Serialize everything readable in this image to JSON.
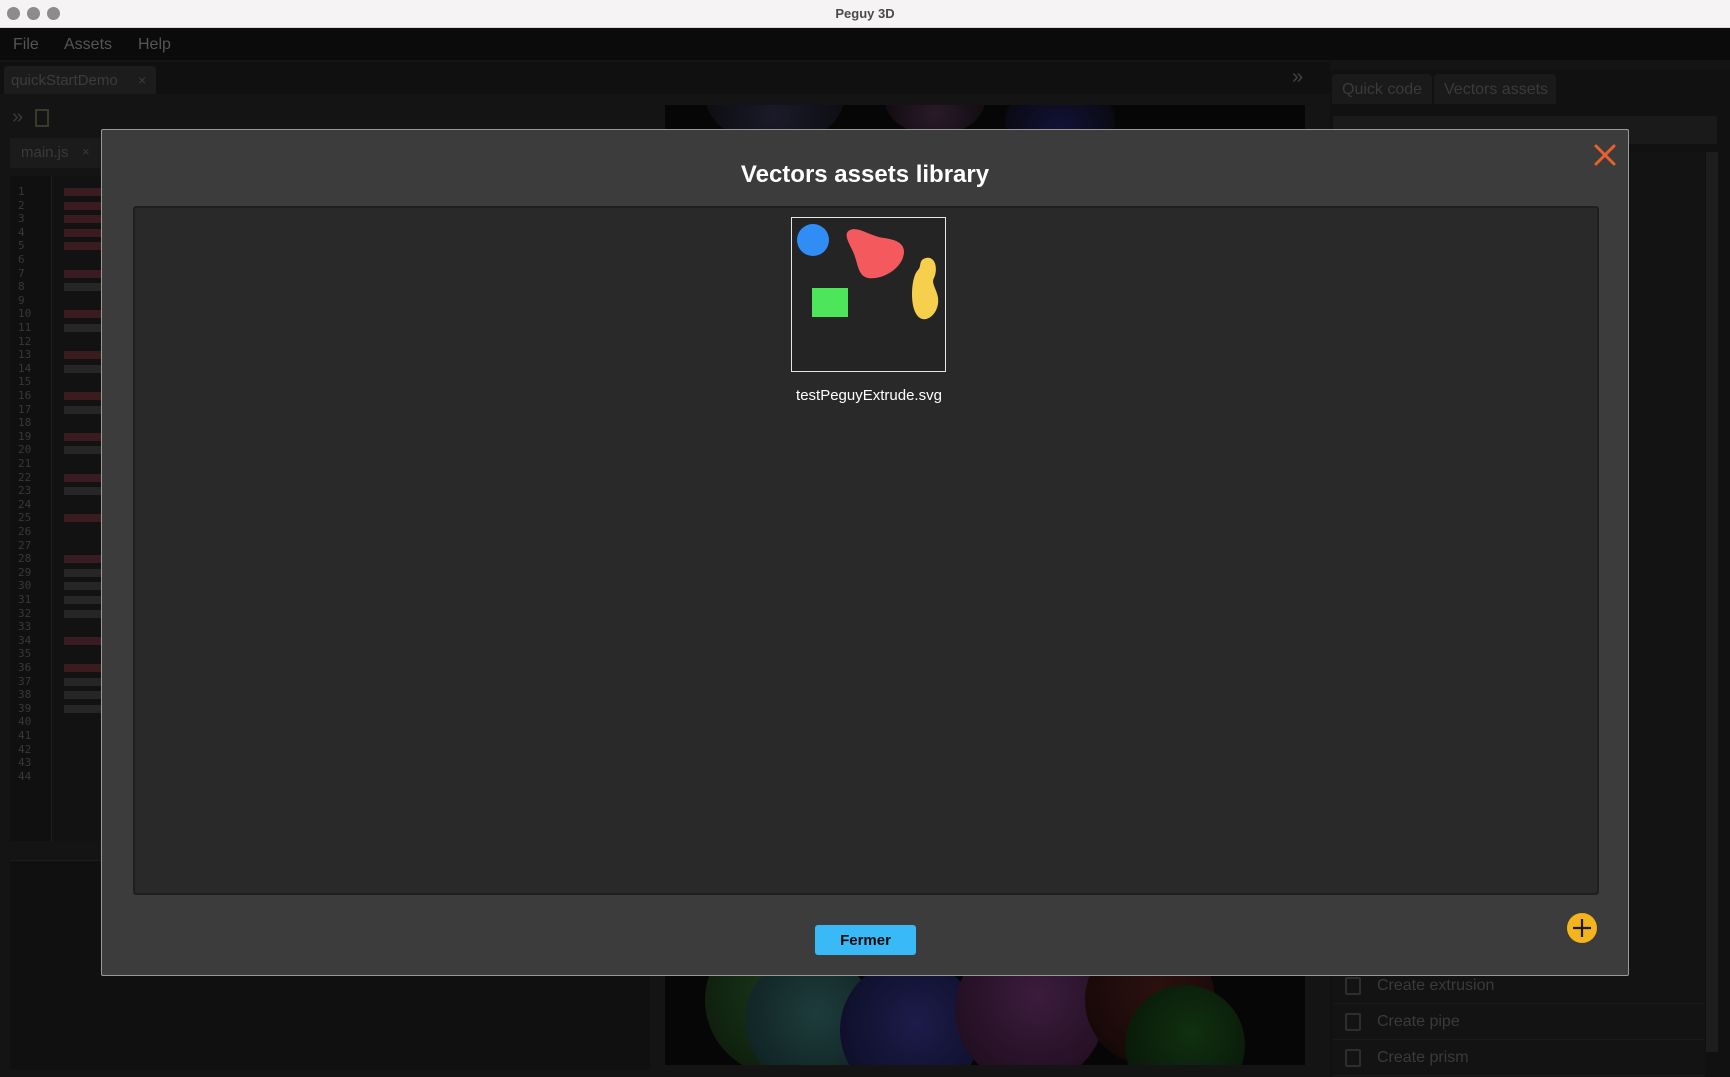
{
  "window": {
    "title": "Peguy 3D"
  },
  "menubar": {
    "items": [
      "File",
      "Assets",
      "Help"
    ]
  },
  "project_tab": {
    "label": "quickStartDemo",
    "close": "×"
  },
  "file_tab": {
    "label": "main.js",
    "close": "×"
  },
  "editor": {
    "line_numbers": [
      "1",
      "2",
      "3",
      "4",
      "5",
      "6",
      "7",
      "8",
      "9",
      "10",
      "11",
      "12",
      "13",
      "14",
      "15",
      "16",
      "17",
      "18",
      "19",
      "20",
      "21",
      "22",
      "23",
      "24",
      "25",
      "26",
      "27",
      "28",
      "29",
      "30",
      "31",
      "32",
      "33",
      "34",
      "35",
      "36",
      "37",
      "38",
      "39",
      "40",
      "41",
      "42",
      "43",
      "44"
    ]
  },
  "right_panel": {
    "tabs": [
      "Quick code",
      "Vectors assets"
    ],
    "visible_items": [
      "Create extrusion",
      "Create pipe",
      "Create prism"
    ]
  },
  "modal": {
    "title": "Vectors assets library",
    "assets": [
      {
        "name": "testPeguyExtrude.svg",
        "shapes": [
          "blue-circle",
          "red-blob",
          "yellow-blob",
          "green-rectangle"
        ]
      }
    ],
    "close_button_label": "Fermer",
    "colors": {
      "close_icon": "#e8602c",
      "add_icon": "#f3b41d",
      "button": "#39b9f6",
      "blue_shape": "#2f8df5",
      "red_shape": "#f45a5d",
      "yellow_shape": "#f6cf4d",
      "green_shape": "#4de55a"
    }
  }
}
